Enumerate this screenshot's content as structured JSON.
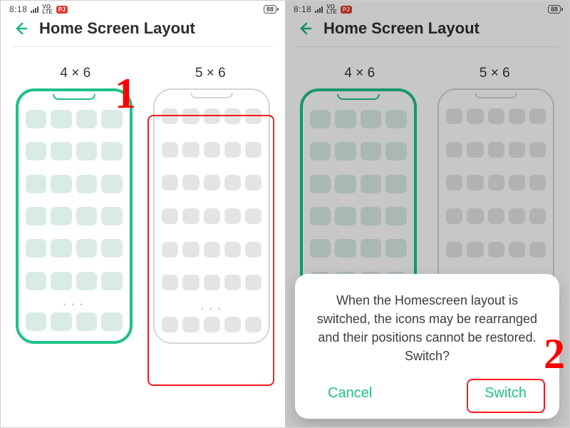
{
  "status": {
    "time": "8:18",
    "volte": "VO\nLTE",
    "chip": "PJ",
    "battery": "88"
  },
  "header": {
    "title": "Home Screen Layout"
  },
  "options": {
    "a": "4 × 6",
    "b": "5 × 6"
  },
  "dialog": {
    "message": "When the Homescreen layout is switched, the icons may be rearranged and their positions cannot be restored. Switch?",
    "cancel": "Cancel",
    "switch": "Switch"
  },
  "steps": {
    "one": "1",
    "two": "2"
  },
  "dots": "• • •"
}
